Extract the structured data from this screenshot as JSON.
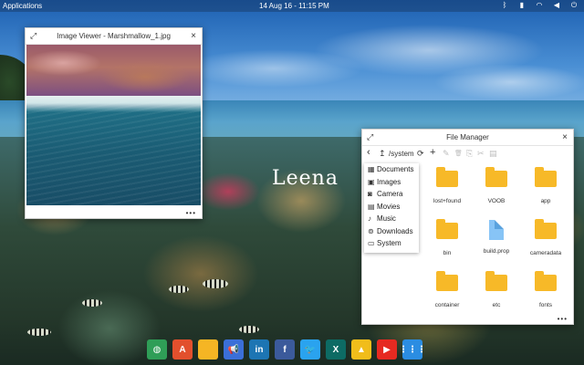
{
  "topbar": {
    "applications_label": "Applications",
    "datetime": "14 Aug 16 - 11:15 PM",
    "tray_icons": [
      "bluetooth-icon",
      "battery-icon",
      "wifi-icon",
      "volume-icon",
      "power-icon"
    ]
  },
  "desktop": {
    "watermark": "Leena"
  },
  "image_viewer": {
    "title": "Image Viewer - Marshmallow_1.jpg",
    "expand_glyph": "⤢",
    "close_glyph": "×",
    "more_glyph": "•••"
  },
  "file_manager": {
    "title": "File Manager",
    "expand_glyph": "⤢",
    "close_glyph": "×",
    "more_glyph": "•••",
    "toolbar": {
      "back_glyph": "‹",
      "up_glyph": "↥",
      "path": "/system",
      "refresh_glyph": "⟳",
      "add_glyph": "+",
      "edit_glyph": "✎",
      "delete_glyph": "🗑",
      "copy_glyph": "⎘",
      "cut_glyph": "✂",
      "paste_glyph": "▤"
    },
    "sidebar": [
      {
        "label": "Documents",
        "icon": "▦"
      },
      {
        "label": "Images",
        "icon": "▣"
      },
      {
        "label": "Camera",
        "icon": "◙"
      },
      {
        "label": "Movies",
        "icon": "▤"
      },
      {
        "label": "Music",
        "icon": "♪"
      },
      {
        "label": "Downloads",
        "icon": "⊚"
      },
      {
        "label": "System",
        "icon": "▭"
      }
    ],
    "items": [
      {
        "label": "lost+found",
        "kind": "folder"
      },
      {
        "label": "VOOB",
        "kind": "folder"
      },
      {
        "label": "app",
        "kind": "folder"
      },
      {
        "label": "bin",
        "kind": "folder"
      },
      {
        "label": "build.prop",
        "kind": "file"
      },
      {
        "label": "cameradata",
        "kind": "folder"
      },
      {
        "label": "container",
        "kind": "folder"
      },
      {
        "label": "etc",
        "kind": "folder"
      },
      {
        "label": "fonts",
        "kind": "folder"
      }
    ]
  },
  "dock": [
    {
      "name": "browser-icon",
      "glyph": "◍",
      "color": "#2f9e57"
    },
    {
      "name": "pdf-icon",
      "glyph": "A",
      "color": "#e2502d"
    },
    {
      "name": "files-icon",
      "glyph": "",
      "color": "#f5b524"
    },
    {
      "name": "announcements-icon",
      "glyph": "📢",
      "color": "#3b6fd8"
    },
    {
      "name": "linkedin-icon",
      "glyph": "in",
      "color": "#1d75b3"
    },
    {
      "name": "facebook-icon",
      "glyph": "f",
      "color": "#3b5a9b"
    },
    {
      "name": "twitter-icon",
      "glyph": "🐦",
      "color": "#2aa3ef"
    },
    {
      "name": "xing-icon",
      "glyph": "X",
      "color": "#0d6b64"
    },
    {
      "name": "drive-icon",
      "glyph": "▲",
      "color": "#f1bd1b"
    },
    {
      "name": "youtube-icon",
      "glyph": "▶",
      "color": "#e62a21"
    },
    {
      "name": "app-grid-icon",
      "glyph": "⋮⋮⋮",
      "color": "#2b8de2"
    }
  ]
}
